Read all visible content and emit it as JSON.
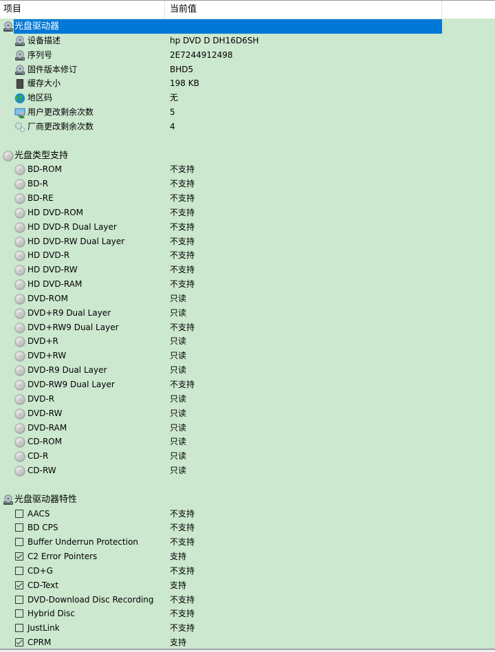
{
  "header": {
    "col_item": "项目",
    "col_value": "当前值"
  },
  "colors": {
    "background": "#cce8cf",
    "selection": "#0078d7",
    "header_bg": "#ffffff"
  },
  "sections": [
    {
      "title": "光盘驱动器",
      "icon": "optical-drive-icon",
      "selected": true,
      "items": [
        {
          "label": "设备描述",
          "value": "hp DVD D  DH16D6SH",
          "icon": "optical-drive-icon"
        },
        {
          "label": "序列号",
          "value": "2E7244912498",
          "icon": "optical-drive-icon"
        },
        {
          "label": "固件版本修订",
          "value": "BHD5",
          "icon": "optical-drive-icon"
        },
        {
          "label": "缓存大小",
          "value": "198 KB",
          "icon": "memory-chip-icon"
        },
        {
          "label": "地区码",
          "value": "无",
          "icon": "globe-icon"
        },
        {
          "label": "用户更改剩余次数",
          "value": "5",
          "icon": "user-monitor-icon"
        },
        {
          "label": "厂商更改剩余次数",
          "value": "4",
          "icon": "gears-icon"
        }
      ]
    },
    {
      "title": "光盘类型支持",
      "icon": "disc-icon",
      "items": [
        {
          "label": "BD-ROM",
          "value": "不支持",
          "icon": "disc-icon"
        },
        {
          "label": "BD-R",
          "value": "不支持",
          "icon": "disc-icon"
        },
        {
          "label": "BD-RE",
          "value": "不支持",
          "icon": "disc-icon"
        },
        {
          "label": "HD DVD-ROM",
          "value": "不支持",
          "icon": "disc-icon"
        },
        {
          "label": "HD DVD-R Dual Layer",
          "value": "不支持",
          "icon": "disc-icon"
        },
        {
          "label": "HD DVD-RW Dual Layer",
          "value": "不支持",
          "icon": "disc-icon"
        },
        {
          "label": "HD DVD-R",
          "value": "不支持",
          "icon": "disc-icon"
        },
        {
          "label": "HD DVD-RW",
          "value": "不支持",
          "icon": "disc-icon"
        },
        {
          "label": "HD DVD-RAM",
          "value": "不支持",
          "icon": "disc-icon"
        },
        {
          "label": "DVD-ROM",
          "value": "只读",
          "icon": "disc-icon"
        },
        {
          "label": "DVD+R9 Dual Layer",
          "value": "只读",
          "icon": "disc-icon"
        },
        {
          "label": "DVD+RW9 Dual Layer",
          "value": "不支持",
          "icon": "disc-icon"
        },
        {
          "label": "DVD+R",
          "value": "只读",
          "icon": "disc-icon"
        },
        {
          "label": "DVD+RW",
          "value": "只读",
          "icon": "disc-icon"
        },
        {
          "label": "DVD-R9 Dual Layer",
          "value": "只读",
          "icon": "disc-icon"
        },
        {
          "label": "DVD-RW9 Dual Layer",
          "value": "不支持",
          "icon": "disc-icon"
        },
        {
          "label": "DVD-R",
          "value": "只读",
          "icon": "disc-icon"
        },
        {
          "label": "DVD-RW",
          "value": "只读",
          "icon": "disc-icon"
        },
        {
          "label": "DVD-RAM",
          "value": "只读",
          "icon": "disc-icon"
        },
        {
          "label": "CD-ROM",
          "value": "只读",
          "icon": "disc-icon"
        },
        {
          "label": "CD-R",
          "value": "只读",
          "icon": "disc-icon"
        },
        {
          "label": "CD-RW",
          "value": "只读",
          "icon": "disc-icon"
        }
      ]
    },
    {
      "title": "光盘驱动器特性",
      "icon": "optical-drive-icon",
      "items": [
        {
          "label": "AACS",
          "value": "不支持",
          "checked": false
        },
        {
          "label": "BD CPS",
          "value": "不支持",
          "checked": false
        },
        {
          "label": "Buffer Underrun Protection",
          "value": "不支持",
          "checked": false
        },
        {
          "label": "C2 Error Pointers",
          "value": "支持",
          "checked": true
        },
        {
          "label": "CD+G",
          "value": "不支持",
          "checked": false
        },
        {
          "label": "CD-Text",
          "value": "支持",
          "checked": true
        },
        {
          "label": "DVD-Download Disc Recording",
          "value": "不支持",
          "checked": false
        },
        {
          "label": "Hybrid Disc",
          "value": "不支持",
          "checked": false
        },
        {
          "label": "JustLink",
          "value": "不支持",
          "checked": false
        },
        {
          "label": "CPRM",
          "value": "支持",
          "checked": true
        }
      ]
    }
  ]
}
